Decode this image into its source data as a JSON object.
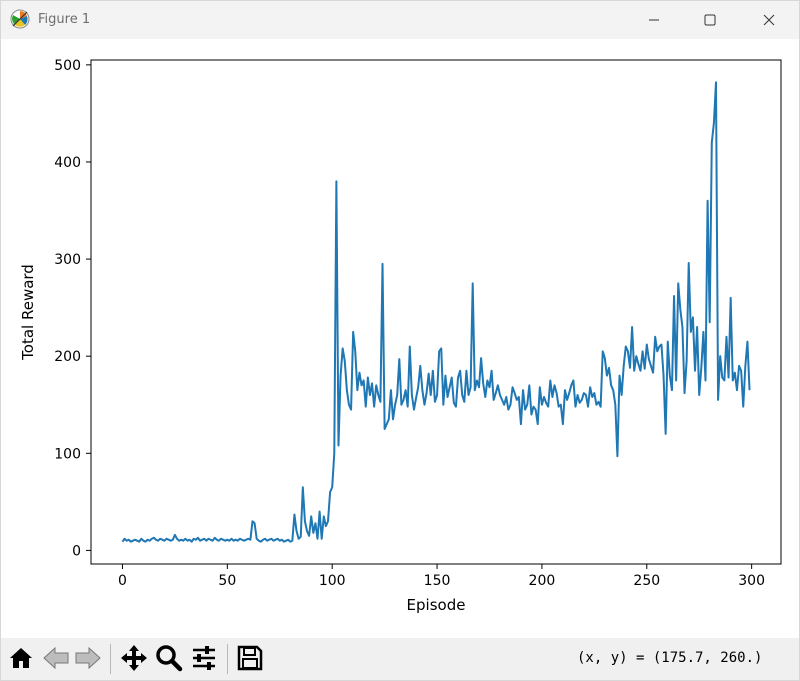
{
  "window": {
    "title": "Figure 1",
    "icon": "matplotlib-icon",
    "controls": [
      "minimize-icon",
      "maximize-icon",
      "close-icon"
    ]
  },
  "toolbar": {
    "buttons": [
      "home-icon",
      "back-arrow-icon",
      "forward-arrow-icon",
      "pan-move-icon",
      "zoom-magnifier-icon",
      "configure-subplots-icon",
      "save-floppy-icon"
    ],
    "coords_text": "(x, y) = (175.7, 260.)"
  },
  "chart_data": {
    "type": "line",
    "title": "",
    "xlabel": "Episode",
    "ylabel": "Total Reward",
    "xlim": [
      -15,
      314
    ],
    "ylim": [
      -14,
      505
    ],
    "xticks": [
      0,
      50,
      100,
      150,
      200,
      250,
      300
    ],
    "yticks": [
      0,
      100,
      200,
      300,
      400,
      500
    ],
    "grid": false,
    "legend": "none",
    "line_color": "#1f77b4",
    "series": [
      {
        "values": [
          9,
          12,
          10,
          11,
          9,
          10,
          11,
          10,
          9,
          12,
          10,
          9,
          11,
          10,
          12,
          13,
          11,
          10,
          12,
          11,
          10,
          12,
          11,
          10,
          11,
          16,
          12,
          10,
          11,
          10,
          12,
          10,
          11,
          9,
          12,
          11,
          13,
          10,
          11,
          12,
          10,
          12,
          11,
          10,
          13,
          11,
          10,
          12,
          11,
          10,
          11,
          10,
          12,
          10,
          11,
          10,
          12,
          11,
          10,
          11,
          12,
          11,
          30,
          28,
          12,
          10,
          9,
          11,
          12,
          10,
          11,
          12,
          10,
          11,
          12,
          10,
          11,
          9,
          10,
          11,
          9,
          10,
          37,
          20,
          12,
          14,
          65,
          30,
          20,
          15,
          35,
          18,
          28,
          12,
          40,
          12,
          35,
          25,
          30,
          60,
          65,
          100,
          380,
          108,
          180,
          208,
          195,
          165,
          150,
          145,
          225,
          205,
          165,
          183,
          170,
          175,
          148,
          178,
          160,
          172,
          148,
          170,
          160,
          153,
          295,
          125,
          130,
          135,
          165,
          135,
          150,
          160,
          197,
          150,
          155,
          165,
          148,
          210,
          160,
          145,
          157,
          168,
          190,
          165,
          150,
          162,
          182,
          160,
          185,
          153,
          160,
          205,
          208,
          150,
          180,
          158,
          168,
          178,
          152,
          148,
          178,
          185,
          160,
          153,
          185,
          160,
          168,
          275,
          165,
          175,
          168,
          198,
          172,
          158,
          175,
          168,
          185,
          155,
          162,
          170,
          160,
          155,
          150,
          158,
          145,
          150,
          168,
          162,
          155,
          158,
          130,
          165,
          145,
          150,
          170,
          140,
          148,
          145,
          130,
          168,
          150,
          158,
          152,
          148,
          175,
          158,
          170,
          162,
          148,
          150,
          130,
          165,
          155,
          162,
          170,
          175,
          148,
          160,
          152,
          155,
          162,
          160,
          148,
          168,
          158,
          162,
          150,
          153,
          148,
          205,
          198,
          180,
          188,
          170,
          165,
          150,
          97,
          180,
          160,
          190,
          210,
          205,
          188,
          230,
          185,
          200,
          192,
          185,
          205,
          187,
          212,
          197,
          190,
          183,
          220,
          205,
          210,
          212,
          180,
          120,
          215,
          180,
          165,
          262,
          175,
          275,
          248,
          230,
          162,
          195,
          296,
          225,
          240,
          185,
          230,
          160,
          188,
          225,
          175,
          360,
          235,
          420,
          440,
          482,
          155,
          200,
          178,
          175,
          220,
          178,
          260,
          175,
          183,
          165,
          190,
          185,
          148,
          190,
          215,
          165
        ]
      }
    ]
  }
}
